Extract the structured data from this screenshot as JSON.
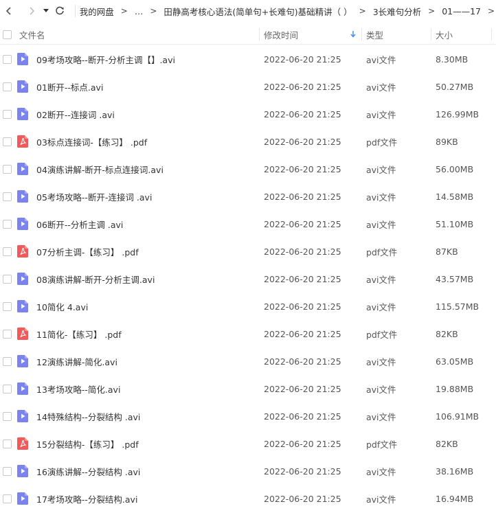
{
  "breadcrumb": {
    "items": [
      "我的网盘",
      "…",
      "田静高考核心语法(简单句+长难句)基础精讲（ ）",
      "3长难句分析",
      "01——17"
    ],
    "separator": ">"
  },
  "columns": {
    "name": "文件名",
    "modified": "修改时间",
    "type": "类型",
    "size": "大小"
  },
  "sort": {
    "column": "modified",
    "direction": "desc"
  },
  "colors": {
    "avi_icon": "#7b83ef",
    "pdf_icon": "#f05a5a",
    "sort_arrow": "#3b8cf7"
  },
  "files": [
    {
      "name": "09考场攻略--断开-分析主调【】.avi",
      "modified": "2022-06-20 21:25",
      "type": "avi文件",
      "size": "8.30MB",
      "icon": "video-file-icon"
    },
    {
      "name": "01断开--标点.avi",
      "modified": "2022-06-20 21:25",
      "type": "avi文件",
      "size": "50.27MB",
      "icon": "video-file-icon"
    },
    {
      "name": "02断开--连接词  .avi",
      "modified": "2022-06-20 21:25",
      "type": "avi文件",
      "size": "126.99MB",
      "icon": "video-file-icon"
    },
    {
      "name": "03标点连接词-【练习】 .pdf",
      "modified": "2022-06-20 21:25",
      "type": "pdf文件",
      "size": "89KB",
      "icon": "pdf-file-icon"
    },
    {
      "name": "04演练讲解-断开-标点连接词.avi",
      "modified": "2022-06-20 21:25",
      "type": "avi文件",
      "size": "56.00MB",
      "icon": "video-file-icon"
    },
    {
      "name": "05考场攻略--断开-连接词  .avi",
      "modified": "2022-06-20 21:25",
      "type": "avi文件",
      "size": "14.58MB",
      "icon": "video-file-icon"
    },
    {
      "name": "06断开--分析主调  .avi",
      "modified": "2022-06-20 21:25",
      "type": "avi文件",
      "size": "51.10MB",
      "icon": "video-file-icon"
    },
    {
      "name": "07分析主调-【练习】  .pdf",
      "modified": "2022-06-20 21:25",
      "type": "pdf文件",
      "size": "87KB",
      "icon": "pdf-file-icon"
    },
    {
      "name": "08演练讲解-断开-分析主调.avi",
      "modified": "2022-06-20 21:25",
      "type": "avi文件",
      "size": "43.57MB",
      "icon": "video-file-icon"
    },
    {
      "name": "10简化  4.avi",
      "modified": "2022-06-20 21:25",
      "type": "avi文件",
      "size": "115.57MB",
      "icon": "video-file-icon"
    },
    {
      "name": "11简化-【练习】  .pdf",
      "modified": "2022-06-20 21:25",
      "type": "pdf文件",
      "size": "82KB",
      "icon": "pdf-file-icon"
    },
    {
      "name": "12演练讲解-简化.avi",
      "modified": "2022-06-20 21:25",
      "type": "avi文件",
      "size": "63.05MB",
      "icon": "video-file-icon"
    },
    {
      "name": "13考场攻略--简化.avi",
      "modified": "2022-06-20 21:25",
      "type": "avi文件",
      "size": "19.88MB",
      "icon": "video-file-icon"
    },
    {
      "name": "14特殊结构--分裂结构  .avi",
      "modified": "2022-06-20 21:25",
      "type": "avi文件",
      "size": "106.91MB",
      "icon": "video-file-icon"
    },
    {
      "name": "15分裂结构-【练习】  .pdf",
      "modified": "2022-06-20 21:25",
      "type": "pdf文件",
      "size": "82KB",
      "icon": "pdf-file-icon"
    },
    {
      "name": "16演练讲解--分裂结构 .avi",
      "modified": "2022-06-20 21:25",
      "type": "avi文件",
      "size": "38.16MB",
      "icon": "video-file-icon"
    },
    {
      "name": "17考场攻略--分裂结构.avi",
      "modified": "2022-06-20 21:25",
      "type": "avi文件",
      "size": "16.94MB",
      "icon": "video-file-icon"
    }
  ]
}
